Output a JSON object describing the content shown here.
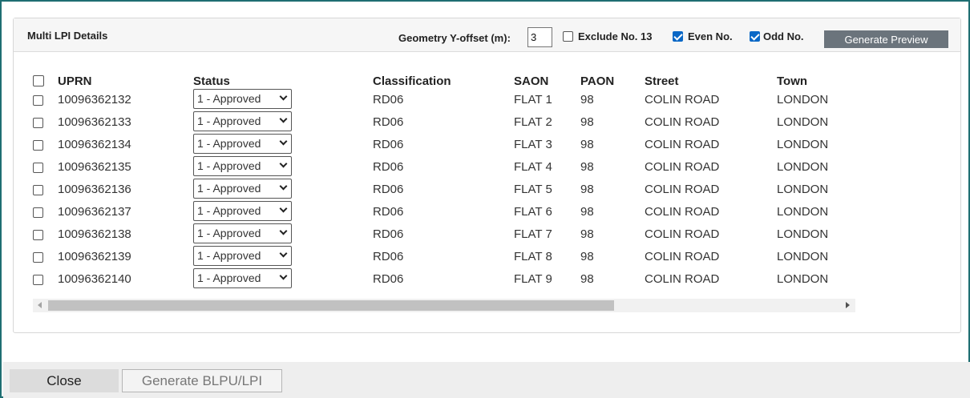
{
  "panel": {
    "title": "Multi LPI Details",
    "offset_label": "Geometry Y-offset (m):",
    "offset_value": "3",
    "exclude13": {
      "label": "Exclude No. 13",
      "checked": false
    },
    "even": {
      "label": "Even No.",
      "checked": true
    },
    "odd": {
      "label": "Odd No.",
      "checked": true
    },
    "preview_label": "Generate Preview"
  },
  "table": {
    "columns": [
      "UPRN",
      "Status",
      "Classification",
      "SAON",
      "PAON",
      "Street",
      "Town"
    ],
    "rows": [
      {
        "uprn": "10096362132",
        "status": "1 - Approved",
        "classification": "RD06",
        "saon": "FLAT 1",
        "paon": "98",
        "street": "COLIN ROAD",
        "town": "LONDON"
      },
      {
        "uprn": "10096362133",
        "status": "1 - Approved",
        "classification": "RD06",
        "saon": "FLAT 2",
        "paon": "98",
        "street": "COLIN ROAD",
        "town": "LONDON"
      },
      {
        "uprn": "10096362134",
        "status": "1 - Approved",
        "classification": "RD06",
        "saon": "FLAT 3",
        "paon": "98",
        "street": "COLIN ROAD",
        "town": "LONDON"
      },
      {
        "uprn": "10096362135",
        "status": "1 - Approved",
        "classification": "RD06",
        "saon": "FLAT 4",
        "paon": "98",
        "street": "COLIN ROAD",
        "town": "LONDON"
      },
      {
        "uprn": "10096362136",
        "status": "1 - Approved",
        "classification": "RD06",
        "saon": "FLAT 5",
        "paon": "98",
        "street": "COLIN ROAD",
        "town": "LONDON"
      },
      {
        "uprn": "10096362137",
        "status": "1 - Approved",
        "classification": "RD06",
        "saon": "FLAT 6",
        "paon": "98",
        "street": "COLIN ROAD",
        "town": "LONDON"
      },
      {
        "uprn": "10096362138",
        "status": "1 - Approved",
        "classification": "RD06",
        "saon": "FLAT 7",
        "paon": "98",
        "street": "COLIN ROAD",
        "town": "LONDON"
      },
      {
        "uprn": "10096362139",
        "status": "1 - Approved",
        "classification": "RD06",
        "saon": "FLAT 8",
        "paon": "98",
        "street": "COLIN ROAD",
        "town": "LONDON"
      },
      {
        "uprn": "10096362140",
        "status": "1 - Approved",
        "classification": "RD06",
        "saon": "FLAT 9",
        "paon": "98",
        "street": "COLIN ROAD",
        "town": "LONDON"
      }
    ]
  },
  "footer": {
    "close_label": "Close",
    "generate_label": "Generate BLPU/LPI"
  },
  "colors": {
    "frame_border": "#1f6e72",
    "checkbox_checked": "#0b68c6",
    "preview_button": "#6b747c"
  }
}
